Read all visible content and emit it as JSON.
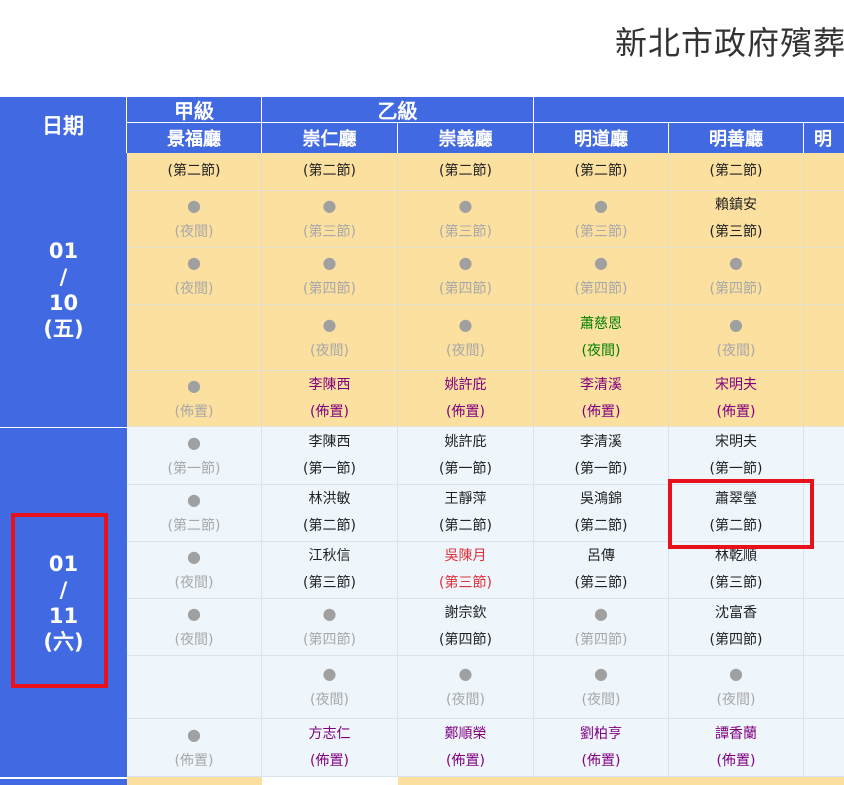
{
  "title": "新北市政府殯葬",
  "header": {
    "date_label": "日期",
    "grades": [
      "甲級",
      "乙級"
    ],
    "halls": [
      "景福廳",
      "崇仁廳",
      "崇義廳",
      "明道廳",
      "明善廳",
      "明"
    ]
  },
  "days": [
    {
      "month": "01",
      "sep": "/",
      "day": "10",
      "weekday": "(五)"
    },
    {
      "month": "01",
      "sep": "/",
      "day": "11",
      "weekday": "(六)"
    }
  ],
  "day1_rows": [
    [
      {
        "name": "",
        "slot": "(第二節)"
      },
      {
        "name": "",
        "slot": "(第二節)"
      },
      {
        "name": "",
        "slot": "(第二節)"
      },
      {
        "name": "",
        "slot": "(第二節)"
      },
      {
        "name": "",
        "slot": "(第二節)"
      }
    ],
    [
      {
        "name": "●",
        "slot": "(夜間)"
      },
      {
        "name": "●",
        "slot": "(第三節)"
      },
      {
        "name": "●",
        "slot": "(第三節)"
      },
      {
        "name": "●",
        "slot": "(第三節)"
      },
      {
        "name": "賴鎮安",
        "slot": "(第三節)"
      }
    ],
    [
      {
        "name": "●",
        "slot": "(夜間)"
      },
      {
        "name": "●",
        "slot": "(第四節)"
      },
      {
        "name": "●",
        "slot": "(第四節)"
      },
      {
        "name": "●",
        "slot": "(第四節)"
      },
      {
        "name": "●",
        "slot": "(第四節)"
      }
    ],
    [
      {
        "name": "",
        "slot": ""
      },
      {
        "name": "●",
        "slot": "(夜間)"
      },
      {
        "name": "●",
        "slot": "(夜間)"
      },
      {
        "name": "蕭慈恩",
        "slot": "(夜間)"
      },
      {
        "name": "●",
        "slot": "(夜間)"
      }
    ],
    [
      {
        "name": "●",
        "slot": "(佈置)"
      },
      {
        "name": "李陳西",
        "slot": "(佈置)"
      },
      {
        "name": "姚許庇",
        "slot": "(佈置)"
      },
      {
        "name": "李清溪",
        "slot": "(佈置)"
      },
      {
        "name": "宋明夫",
        "slot": "(佈置)"
      }
    ]
  ],
  "day2_rows": [
    [
      {
        "name": "●",
        "slot": "(第一節)"
      },
      {
        "name": "李陳西",
        "slot": "(第一節)"
      },
      {
        "name": "姚許庇",
        "slot": "(第一節)"
      },
      {
        "name": "李清溪",
        "slot": "(第一節)"
      },
      {
        "name": "宋明夫",
        "slot": "(第一節)"
      }
    ],
    [
      {
        "name": "●",
        "slot": "(第二節)"
      },
      {
        "name": "林洪敏",
        "slot": "(第二節)"
      },
      {
        "name": "王靜萍",
        "slot": "(第二節)"
      },
      {
        "name": "吳鴻錦",
        "slot": "(第二節)"
      },
      {
        "name": "蕭翠瑩",
        "slot": "(第二節)"
      }
    ],
    [
      {
        "name": "●",
        "slot": "(夜間)"
      },
      {
        "name": "江秋信",
        "slot": "(第三節)"
      },
      {
        "name": "吳陳月",
        "slot": "(第三節)"
      },
      {
        "name": "呂傳",
        "slot": "(第三節)"
      },
      {
        "name": "林乾順",
        "slot": "(第三節)"
      }
    ],
    [
      {
        "name": "●",
        "slot": "(夜間)"
      },
      {
        "name": "●",
        "slot": "(第四節)"
      },
      {
        "name": "謝宗欽",
        "slot": "(第四節)"
      },
      {
        "name": "●",
        "slot": "(第四節)"
      },
      {
        "name": "沈富香",
        "slot": "(第四節)"
      }
    ],
    [
      {
        "name": "",
        "slot": ""
      },
      {
        "name": "●",
        "slot": "(夜間)"
      },
      {
        "name": "●",
        "slot": "(夜間)"
      },
      {
        "name": "●",
        "slot": "(夜間)"
      },
      {
        "name": "●",
        "slot": "(夜間)"
      }
    ],
    [
      {
        "name": "●",
        "slot": "(佈置)"
      },
      {
        "name": "方志仁",
        "slot": "(佈置)"
      },
      {
        "name": "鄭順榮",
        "slot": "(佈置)"
      },
      {
        "name": "劉柏亨",
        "slot": "(佈置)"
      },
      {
        "name": "譚香蘭",
        "slot": "(佈置)"
      }
    ]
  ],
  "colors": {
    "header_blue": "#4169e1",
    "day1_bg": "#fce0a0",
    "day2_bg": "#eef6fc",
    "highlight": "#e8101a"
  }
}
